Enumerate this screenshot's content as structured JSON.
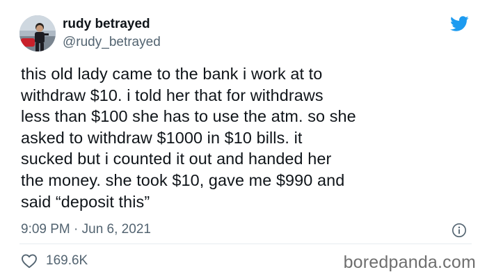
{
  "tweet": {
    "display_name": "rudy betrayed",
    "handle": "@rudy_betrayed",
    "text": "this old lady came to the bank i work at to\nwithdraw $10. i told her that for withdraws\nless than $100 she has to use the atm. so she\nasked to withdraw $1000 in $10 bills. it\nsucked but i counted it out and handed her\nthe money. she took $10, gave me $990 and\nsaid “deposit this”",
    "timestamp": "9:09 PM · Jun 6, 2021",
    "likes": "169.6K"
  },
  "watermark": "boredpanda.com",
  "icons": {
    "brand": "twitter-bird-icon",
    "info": "info-icon",
    "like": "heart-icon"
  },
  "colors": {
    "twitter_blue": "#1d9bf0",
    "text": "#0f1419",
    "secondary": "#536471"
  }
}
